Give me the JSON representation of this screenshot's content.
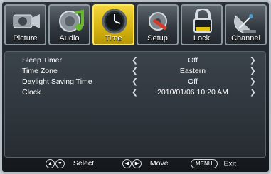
{
  "tabs": [
    {
      "label": "Picture",
      "icon": "camcorder-icon",
      "active": false
    },
    {
      "label": "Audio",
      "icon": "music-note-icon",
      "active": false
    },
    {
      "label": "Time",
      "icon": "clock-icon",
      "active": true
    },
    {
      "label": "Setup",
      "icon": "tools-icon",
      "active": false
    },
    {
      "label": "Lock",
      "icon": "padlock-icon",
      "active": false
    },
    {
      "label": "Channel",
      "icon": "satellite-dish-icon",
      "active": false
    }
  ],
  "settings": [
    {
      "name": "Sleep Timer",
      "value": "Off"
    },
    {
      "name": "Time Zone",
      "value": "Eastern"
    },
    {
      "name": "Daylight Saving Time",
      "value": "Off"
    },
    {
      "name": "Clock",
      "value": "2010/01/06 10:20 AM"
    }
  ],
  "footer": {
    "select_label": "Select",
    "move_label": "Move",
    "menu_key": "MENU",
    "exit_label": "Exit"
  },
  "colors": {
    "active_tab": "#e4c21b",
    "panel_bg": "#30373d",
    "text": "#ffffff"
  }
}
